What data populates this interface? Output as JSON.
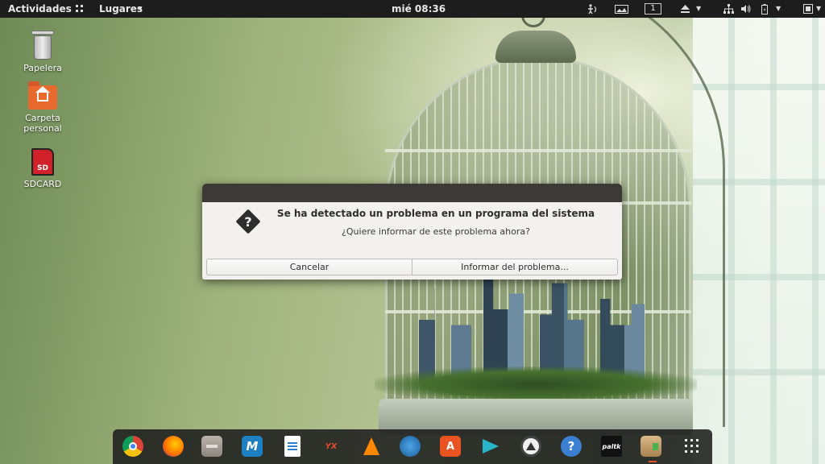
{
  "topbar": {
    "activities": "Actividades",
    "places": "Lugares",
    "places_arrow": "▾",
    "clock": "mié 08:36",
    "workspace": "1",
    "indicators": [
      "accessibility-icon",
      "display-icon",
      "eject-icon",
      "network-icon",
      "volume-icon",
      "battery-icon",
      "system-menu-icon"
    ]
  },
  "desktop": {
    "trash_label": "Papelera",
    "home_label_1": "Carpeta",
    "home_label_2": "personal",
    "sd_label": "SDCARD",
    "sd_badge": "SD"
  },
  "dialog": {
    "title": "Se ha detectado un problema en un programa del sistema",
    "message": "¿Quiere informar de este problema ahora?",
    "cancel_label": "Cancelar",
    "report_label": "Informar del problema..."
  },
  "dock": {
    "items": [
      {
        "name": "chrome-icon",
        "text": ""
      },
      {
        "name": "firefox-icon",
        "text": ""
      },
      {
        "name": "file-manager-icon",
        "text": ""
      },
      {
        "name": "mendeley-icon",
        "text": "M"
      },
      {
        "name": "writer-icon",
        "text": ""
      },
      {
        "name": "yx-app-icon",
        "text": "YX"
      },
      {
        "name": "vlc-icon",
        "text": ""
      },
      {
        "name": "inkscape-icon",
        "text": ""
      },
      {
        "name": "software-center-icon",
        "text": "A"
      },
      {
        "name": "cursor-app-icon",
        "text": ""
      },
      {
        "name": "software-updater-icon",
        "text": ""
      },
      {
        "name": "help-icon",
        "text": "?"
      },
      {
        "name": "paltalk-icon",
        "text": "paltk"
      },
      {
        "name": "archive-manager-icon",
        "text": ""
      },
      {
        "name": "show-apps-icon",
        "text": ""
      }
    ]
  },
  "colors": {
    "topbar_bg": "#1d1d1d",
    "dialog_bg": "#f2f1f0",
    "dialog_titlebar": "#3b3a37",
    "accent": "#e95420"
  }
}
